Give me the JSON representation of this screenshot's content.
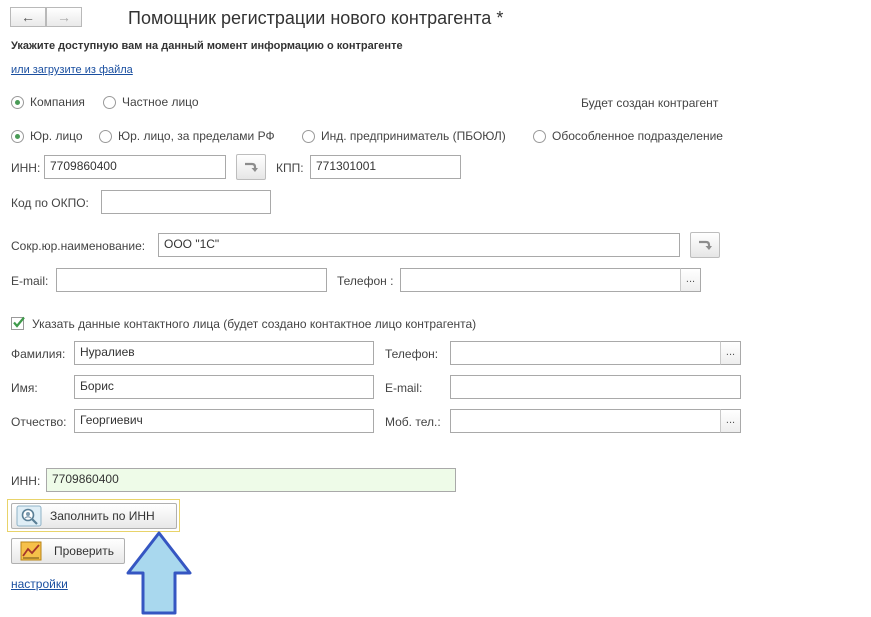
{
  "window": {
    "title": "Помощник регистрации нового контрагента *",
    "subtitle": "Укажите доступную вам на данный момент информацию о контрагенте",
    "load_link": "или загрузите из файла",
    "will_create": "Будет создан контрагент"
  },
  "type_group": {
    "options": [
      {
        "label": "Компания",
        "selected": true
      },
      {
        "label": "Частное лицо",
        "selected": false
      }
    ]
  },
  "legal_group": {
    "options": [
      {
        "label": "Юр. лицо",
        "selected": true
      },
      {
        "label": "Юр. лицо, за пределами РФ",
        "selected": false
      },
      {
        "label": "Инд. предприниматель (ПБОЮЛ)",
        "selected": false
      },
      {
        "label": "Обособленное подразделение",
        "selected": false
      }
    ]
  },
  "company": {
    "inn_label": "ИНН:",
    "inn_value": "7709860400",
    "kpp_label": "КПП:",
    "kpp_value": "771301001",
    "okpo_label": "Код по ОКПО:",
    "okpo_value": "",
    "short_name_label": "Сокр.юр.наименование:",
    "short_name_value": "ООО \"1С\"",
    "email_label": "E-mail:",
    "email_value": "",
    "phone_label": "Телефон :",
    "phone_value": ""
  },
  "contact": {
    "checkbox_label": "Указать данные контактного лица (будет создано контактное лицо контрагента)",
    "checked": true,
    "surname_label": "Фамилия:",
    "surname_value": "Нуралиев",
    "name_label": "Имя:",
    "name_value": "Борис",
    "patronymic_label": "Отчество:",
    "patronymic_value": "Георгиевич",
    "phone_label": "Телефон:",
    "phone_value": "",
    "email_label": "E-mail:",
    "email_value": "",
    "mobile_label": "Моб. тел.:",
    "mobile_value": ""
  },
  "bottom": {
    "inn_label": "ИНН:",
    "inn_value": "7709860400",
    "fill_button": "Заполнить по ИНН",
    "check_button": "Проверить",
    "settings_link": "настройки"
  },
  "ellipsis": "...",
  "colors": {
    "accent_green": "#4a9b57",
    "highlight_border": "#e8d36a",
    "arrow_fill": "#a9d8ee",
    "arrow_stroke": "#3556c2",
    "link": "#1a4fa0"
  }
}
